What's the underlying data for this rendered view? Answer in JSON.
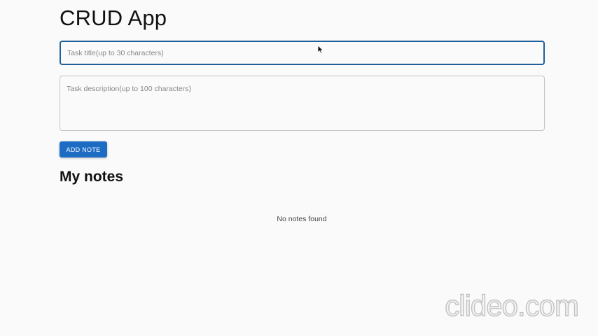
{
  "app": {
    "title": "CRUD App"
  },
  "form": {
    "title_placeholder": "Task title(up to 30 characters)",
    "title_value": "",
    "description_placeholder": "Task description(up to 100 characters)",
    "description_value": "",
    "add_button_label": "ADD NOTE"
  },
  "notes": {
    "heading": "My notes",
    "empty_message": "No notes found",
    "items": []
  },
  "watermark": {
    "text": "clideo.com"
  },
  "colors": {
    "accent": "#1c6cc4",
    "focused_border": "#1f5f9a"
  },
  "icons": {
    "cursor": "mouse-pointer-icon"
  }
}
